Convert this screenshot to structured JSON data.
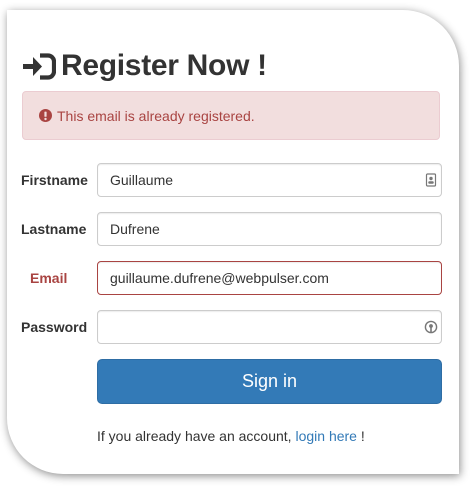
{
  "header": {
    "title": "Register Now !",
    "icon": "sign-in-icon"
  },
  "alert": {
    "icon": "exclamation-circle-icon",
    "message": "This email is already registered.",
    "color": "#a94442",
    "background": "#f2dede"
  },
  "form": {
    "firstname": {
      "label": "Firstname",
      "value": "Guillaume",
      "icon": "contact-card-icon"
    },
    "lastname": {
      "label": "Lastname",
      "value": "Dufrene"
    },
    "email": {
      "label": "Email",
      "value": "guillaume.dufrene@webpulser.com",
      "state": "error"
    },
    "password": {
      "label": "Password",
      "value": "",
      "icon": "password-key-icon"
    },
    "submit_label": "Sign in"
  },
  "footer": {
    "text_before": "If you already have an account, ",
    "link_text": "login here",
    "text_after": " !"
  },
  "colors": {
    "primary": "#337ab7",
    "error": "#a94442",
    "text": "#333333"
  }
}
